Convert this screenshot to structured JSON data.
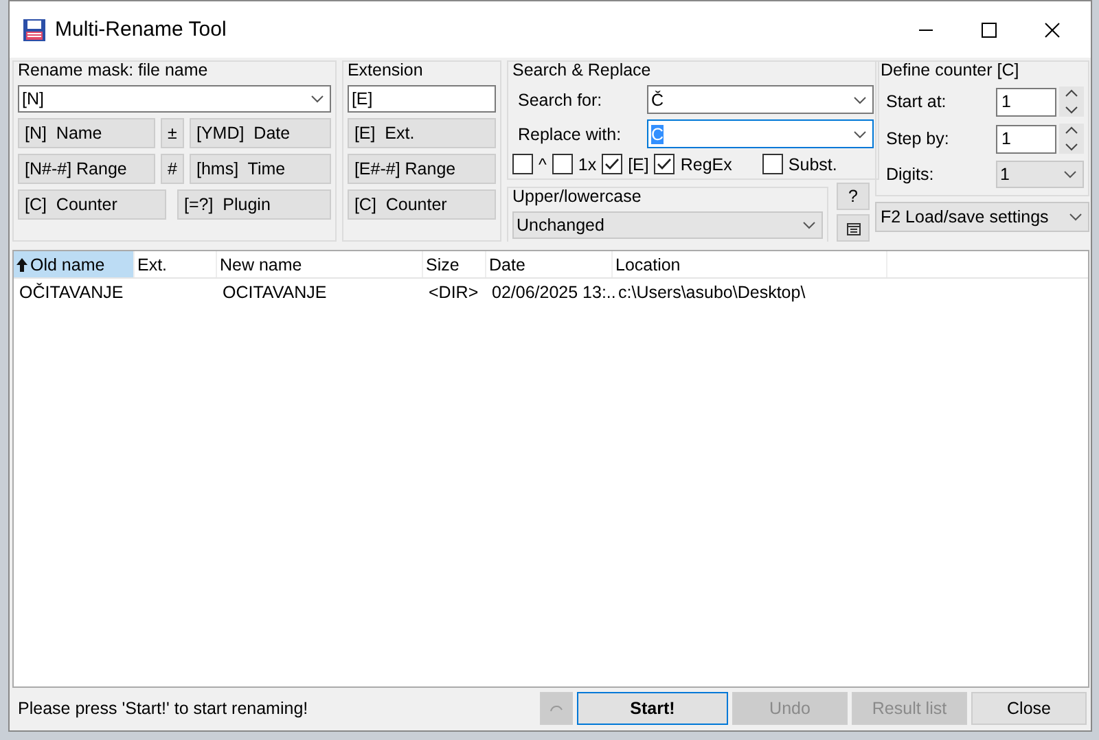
{
  "window": {
    "title": "Multi-Rename Tool"
  },
  "rename_mask": {
    "label": "Rename mask: file name",
    "value": "[N]",
    "button_rows": [
      [
        "[N]  Name",
        "±",
        "[YMD]  Date"
      ],
      [
        "[N#-#] Range",
        "#",
        "[hms]  Time"
      ],
      [
        "[C]  Counter",
        "[=?]  Plugin"
      ]
    ]
  },
  "extension": {
    "label": "Extension",
    "value": "[E]",
    "buttons": [
      "[E]  Ext.",
      "[E#-#] Range",
      "[C]  Counter"
    ]
  },
  "search_replace": {
    "label": "Search & Replace",
    "search_label": "Search for:",
    "search_value": "Č",
    "replace_label": "Replace with:",
    "replace_value": "C",
    "replace_focused": true,
    "options": [
      {
        "label": "^",
        "checked": false
      },
      {
        "label": "1x",
        "checked": false
      },
      {
        "label": "[E]",
        "checked": true
      },
      {
        "label": "RegEx",
        "checked": true
      },
      {
        "label": "Subst.",
        "checked": false
      }
    ]
  },
  "case": {
    "label": "Upper/lowercase",
    "value": "Unchanged",
    "help_button": "?"
  },
  "counter": {
    "label": "Define counter [C]",
    "start_label": "Start at:",
    "start_value": "1",
    "step_label": "Step by:",
    "step_value": "1",
    "digits_label": "Digits:",
    "digits_value": "1"
  },
  "settings": {
    "label": "F2 Load/save settings"
  },
  "table": {
    "columns": [
      {
        "label": "Old name",
        "sorted": true
      },
      {
        "label": "Ext.",
        "sorted": false
      },
      {
        "label": "New name",
        "sorted": false
      },
      {
        "label": "Size",
        "sorted": false
      },
      {
        "label": "Date",
        "sorted": false
      },
      {
        "label": "Location",
        "sorted": false
      }
    ],
    "rows": [
      {
        "cells": [
          "OČITAVANJE",
          "",
          "OCITAVANJE",
          "<DIR>",
          "02/06/2025 13:..",
          "c:\\Users\\asubo\\Desktop\\"
        ]
      }
    ]
  },
  "status_bar": {
    "message": "Please press 'Start!' to start renaming!"
  },
  "buttons": [
    {
      "label": "Start!",
      "disabled": false,
      "default": true
    },
    {
      "label": "Undo",
      "disabled": true,
      "default": false
    },
    {
      "label": "Result list",
      "disabled": true,
      "default": false
    },
    {
      "label": "Close",
      "disabled": false,
      "default": false
    }
  ]
}
